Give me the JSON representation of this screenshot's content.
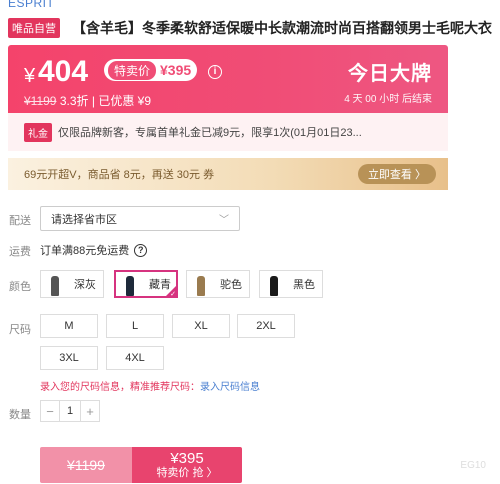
{
  "brand": "ESPRIT",
  "title": {
    "badge": "唯品自营",
    "text": "【含羊毛】冬季柔软舒适保暖中长款潮流时尚百搭翻领男士毛呢大衣"
  },
  "price": {
    "currency": "¥",
    "value": "404",
    "special_label": "特卖价",
    "special_value": "¥395",
    "original": "¥1199",
    "discount": "3.3折",
    "saved": "已优惠 ¥9",
    "sale_title": "今日大牌",
    "countdown": "4 天 00 小时 后结束",
    "colors": {
      "primary": "#f04d76",
      "badge": "#e2355d"
    }
  },
  "coupon": {
    "badge": "礼金",
    "text": "仅限品牌新客，专属首单礼金已减9元，限享1次(01月01日23..."
  },
  "vip": {
    "text": "69元开超V，商品省 8元，再送 30元 券",
    "button": "立即查看 〉"
  },
  "delivery": {
    "label": "配送",
    "placeholder": "请选择省市区"
  },
  "shipping": {
    "label": "运费",
    "text": "订单满88元免运费"
  },
  "color": {
    "label": "颜色",
    "options": [
      {
        "name": "深灰",
        "tone": "#555555"
      },
      {
        "name": "藏青",
        "tone": "#1e2a3a",
        "selected": true
      },
      {
        "name": "驼色",
        "tone": "#9a7b4f"
      },
      {
        "name": "黑色",
        "tone": "#1a1a1a"
      }
    ]
  },
  "size": {
    "label": "尺码",
    "options": [
      "M",
      "L",
      "XL",
      "2XL",
      "3XL",
      "4XL"
    ],
    "hint": "录入您的尺码信息，精准推荐尺码：",
    "hint_link": "录入尺码信息"
  },
  "quantity": {
    "label": "数量",
    "value": "1",
    "minus": "−",
    "plus": "+"
  },
  "buy": {
    "original": "¥1199",
    "price": "¥395",
    "action": "特卖价 抢 〉"
  },
  "watermark": "EG10"
}
